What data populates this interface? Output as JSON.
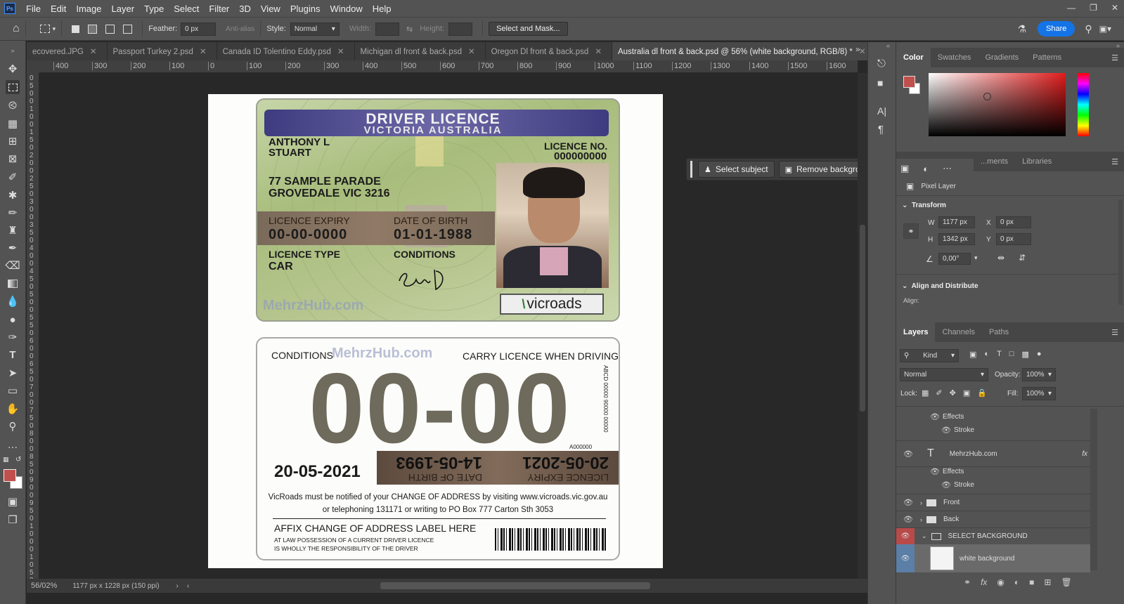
{
  "app": {
    "logo": "Ps",
    "menus": [
      "File",
      "Edit",
      "Image",
      "Layer",
      "Type",
      "Select",
      "Filter",
      "3D",
      "View",
      "Plugins",
      "Window",
      "Help"
    ]
  },
  "options": {
    "feather_label": "Feather:",
    "feather_value": "0 px",
    "antialias_label": "Anti-alias",
    "style_label": "Style:",
    "style_value": "Normal",
    "width_label": "Width:",
    "height_label": "Height:",
    "select_mask": "Select and Mask...",
    "share": "Share"
  },
  "tabs": [
    {
      "label": "ecovered.JPG"
    },
    {
      "label": "Passport Turkey 2.psd"
    },
    {
      "label": "Canada ID Tolentino Eddy.psd"
    },
    {
      "label": "Michigan dl front & back.psd"
    },
    {
      "label": "Oregon Dl front & back.psd"
    },
    {
      "label": "Australia dl front & back.psd @ 56% (white background, RGB/8) *"
    }
  ],
  "ruler_h": [
    "400",
    "300",
    "200",
    "100",
    "0",
    "100",
    "200",
    "300",
    "400",
    "500",
    "600",
    "700",
    "800",
    "900",
    "1000",
    "1100",
    "1200",
    "1300",
    "1400",
    "1500",
    "1600"
  ],
  "ruler_v": [
    "0",
    "5",
    "0",
    "0",
    "1",
    "0",
    "0",
    "1",
    "5",
    "0",
    "2",
    "0",
    "0",
    "2",
    "5",
    "0",
    "3",
    "0",
    "0",
    "3",
    "5",
    "0",
    "4",
    "0",
    "0",
    "4",
    "5",
    "0",
    "5",
    "0",
    "0",
    "5",
    "5",
    "0",
    "6",
    "0",
    "0",
    "6",
    "5",
    "0",
    "7",
    "0",
    "0",
    "7",
    "5",
    "0",
    "8",
    "0",
    "0",
    "8",
    "5",
    "0",
    "9",
    "0",
    "0",
    "9",
    "5",
    "0",
    "1",
    "0",
    "0",
    "0",
    "1",
    "0",
    "5",
    "0"
  ],
  "front": {
    "title": "DRIVER LICENCE",
    "subtitle": "VICTORIA AUSTRALIA",
    "name1": "ANTHONY L",
    "name2": "STUART",
    "licno_label": "LICENCE NO.",
    "licno": "000000000",
    "addr1": "77 SAMPLE PARADE",
    "addr2": "GROVEDALE VIC 3216",
    "expiry_label": "LICENCE EXPIRY",
    "expiry": "00-00-0000",
    "dob_label": "DATE OF BIRTH",
    "dob": "01-01-1988",
    "type_label": "LICENCE TYPE",
    "type": "CAR",
    "cond_label": "CONDITIONS",
    "watermark": "MehrzHub.com",
    "brand": "vicroads"
  },
  "back": {
    "cond_label": "CONDITIONS",
    "watermark": "MehrzHub.com",
    "carry": "CARRY LICENCE WHEN DRIVING",
    "big": "00-00",
    "side": "ABCD 00000 90000 00000",
    "small_code": "A000000",
    "date": "20-05-2021",
    "dob_label": "DATE OF BIRTH",
    "dob": "14-05-1993",
    "exp_label": "LICENCE EXPIRY",
    "exp": "20-05-2021",
    "notice1": "VicRoads must be notified of your CHANGE OF ADDRESS by visiting www.vicroads.vic.gov.au",
    "notice2": "or telephoning 131171 or writing to PO Box 777 Carton Sth 3053",
    "affix": "AFFIX CHANGE OF ADDRESS LABEL HERE",
    "law1": "AT LAW POSSESSION OF A CURRENT DRIVER LICENCE",
    "law2": "IS WHOLLY THE RESPONSIBILITY OF THE DRIVER"
  },
  "context": {
    "select_subject": "Select subject",
    "remove_bg": "Remove background"
  },
  "status": {
    "zoom": "56/02%",
    "info": "1177 px x 1228 px (150 ppi)"
  },
  "color_panel": {
    "tabs": [
      "Color",
      "Swatches",
      "Gradients",
      "Patterns"
    ],
    "fg": "#c0504d"
  },
  "props": {
    "tabs": [
      "...ments",
      "Libraries"
    ],
    "pixel_layer": "Pixel Layer",
    "transform": "Transform",
    "w_label": "W",
    "w": "1177 px",
    "h_label": "H",
    "h": "1342 px",
    "x_label": "X",
    "x": "0 px",
    "y_label": "Y",
    "y": "0 px",
    "angle": "0,00°",
    "align": "Align and Distribute",
    "align_sub": "Align:"
  },
  "layers": {
    "tabs": [
      "Layers",
      "Channels",
      "Paths"
    ],
    "kind": "Kind",
    "blend": "Normal",
    "opacity_label": "Opacity:",
    "opacity": "100%",
    "lock_label": "Lock:",
    "fill_label": "Fill:",
    "fill": "100%",
    "items": [
      {
        "name": "Effects",
        "kind": "fx"
      },
      {
        "name": "Stroke",
        "kind": "fxsub"
      },
      {
        "name": "MehrzHub.com",
        "kind": "text"
      },
      {
        "name": "Effects",
        "kind": "fx"
      },
      {
        "name": "Stroke",
        "kind": "fxsub"
      },
      {
        "name": "Front",
        "kind": "group"
      },
      {
        "name": "Back",
        "kind": "group"
      },
      {
        "name": "SELECT BACKGROUND",
        "kind": "group"
      },
      {
        "name": "white background",
        "kind": "pixel"
      }
    ]
  }
}
